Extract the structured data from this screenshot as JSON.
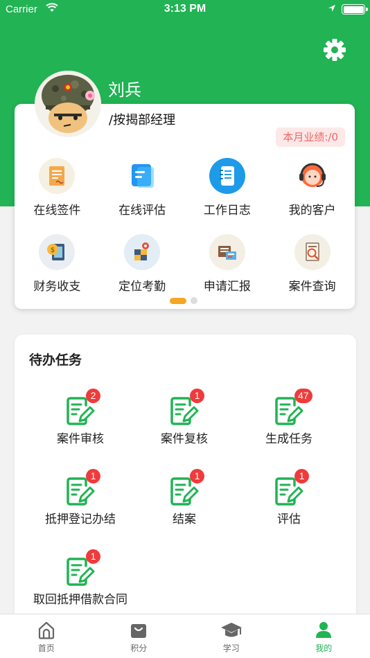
{
  "status_bar": {
    "carrier": "Carrier",
    "time": "3:13 PM"
  },
  "profile": {
    "name": "刘兵",
    "role": "/按揭部经理",
    "performance": "本月业绩:/0"
  },
  "quick_actions": [
    {
      "label": "在线签件",
      "icon": "document-sign-icon"
    },
    {
      "label": "在线评估",
      "icon": "evaluation-icon"
    },
    {
      "label": "工作日志",
      "icon": "notebook-icon"
    },
    {
      "label": "我的客户",
      "icon": "customer-service-icon"
    },
    {
      "label": "财务收支",
      "icon": "finance-icon"
    },
    {
      "label": "定位考勤",
      "icon": "location-attendance-icon"
    },
    {
      "label": "申请汇报",
      "icon": "report-icon"
    },
    {
      "label": "案件查询",
      "icon": "case-search-icon"
    }
  ],
  "tasks": {
    "title": "待办任务",
    "items": [
      {
        "label": "案件审核",
        "badge": "2"
      },
      {
        "label": "案件复核",
        "badge": "1"
      },
      {
        "label": "生成任务",
        "badge": "47"
      },
      {
        "label": "抵押登记办结",
        "badge": "1"
      },
      {
        "label": "结案",
        "badge": "1"
      },
      {
        "label": "评估",
        "badge": "1"
      },
      {
        "label": "取回抵押借款合同",
        "badge": "1"
      }
    ]
  },
  "tabs": [
    {
      "label": "首页",
      "icon": "home-icon"
    },
    {
      "label": "积分",
      "icon": "shopping-bag-icon"
    },
    {
      "label": "学习",
      "icon": "graduation-cap-icon"
    },
    {
      "label": "我的",
      "icon": "user-icon",
      "active": true
    }
  ],
  "colors": {
    "accent": "#21b354",
    "badge": "#ef3b3b",
    "page_dot": "#f5a623"
  }
}
